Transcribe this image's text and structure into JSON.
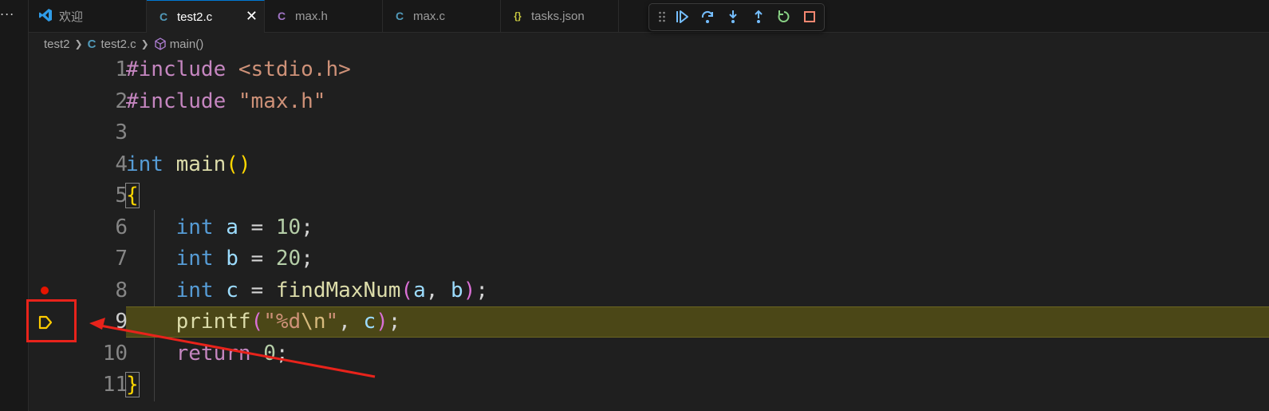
{
  "activity": {
    "more_icon": "ellipsis-icon",
    "more_label": "..."
  },
  "tabs": [
    {
      "label": "欢迎",
      "icon": "vscode-icon",
      "active": false
    },
    {
      "label": "test2.c",
      "icon": "c-file-icon",
      "icon_text": "C",
      "active": true,
      "close": "✕"
    },
    {
      "label": "max.h",
      "icon": "c-header-icon",
      "icon_text": "C",
      "active": false
    },
    {
      "label": "max.c",
      "icon": "c-file-icon",
      "icon_text": "C",
      "active": false
    },
    {
      "label": "tasks.json",
      "icon": "json-icon",
      "icon_text": "{}",
      "active": false
    }
  ],
  "debug_toolbar": {
    "buttons": [
      "drag-handle-icon",
      "continue-icon",
      "step-over-icon",
      "step-into-icon",
      "step-out-icon",
      "restart-icon",
      "stop-icon"
    ]
  },
  "breadcrumb": {
    "folder": "test2",
    "file_icon": "C",
    "file": "test2.c",
    "symbol": "main()"
  },
  "editor": {
    "line_numbers": [
      "1",
      "2",
      "3",
      "4",
      "5",
      "6",
      "7",
      "8",
      "9",
      "10",
      "11"
    ],
    "current_line": 9,
    "breakpoint_line": 8
  },
  "code": {
    "l1_inc": "#include",
    "l1_hdr": "<stdio.h>",
    "l2_inc": "#include",
    "l2_hdr": "\"max.h\"",
    "l4_type": "int",
    "l4_fn": "main",
    "l4_paren": "()",
    "l5_brace": "{",
    "l6_type": "int",
    "l6_var": "a",
    "l6_eq": " = ",
    "l6_num": "10",
    "l6_end": ";",
    "l7_type": "int",
    "l7_var": "b",
    "l7_eq": " = ",
    "l7_num": "20",
    "l7_end": ";",
    "l8_type": "int",
    "l8_var": "c",
    "l8_eq": " = ",
    "l8_fn": "findMaxNum",
    "l8_p1": "(",
    "l8_a": "a",
    "l8_comma": ", ",
    "l8_b": "b",
    "l8_p2": ")",
    "l8_end": ";",
    "l9_fn": "printf",
    "l9_p1": "(",
    "l9_q1": "\"%d",
    "l9_esc": "\\n",
    "l9_q2": "\"",
    "l9_comma": ", ",
    "l9_var": "c",
    "l9_p2": ")",
    "l9_end": ";",
    "l10_ret": "return",
    "l10_num": "0",
    "l10_end": ";",
    "l11_brace": "}"
  },
  "colors": {
    "breakpoint": "#e51400",
    "current_line_highlight": "#4b4717",
    "annotation": "#e8231b"
  }
}
